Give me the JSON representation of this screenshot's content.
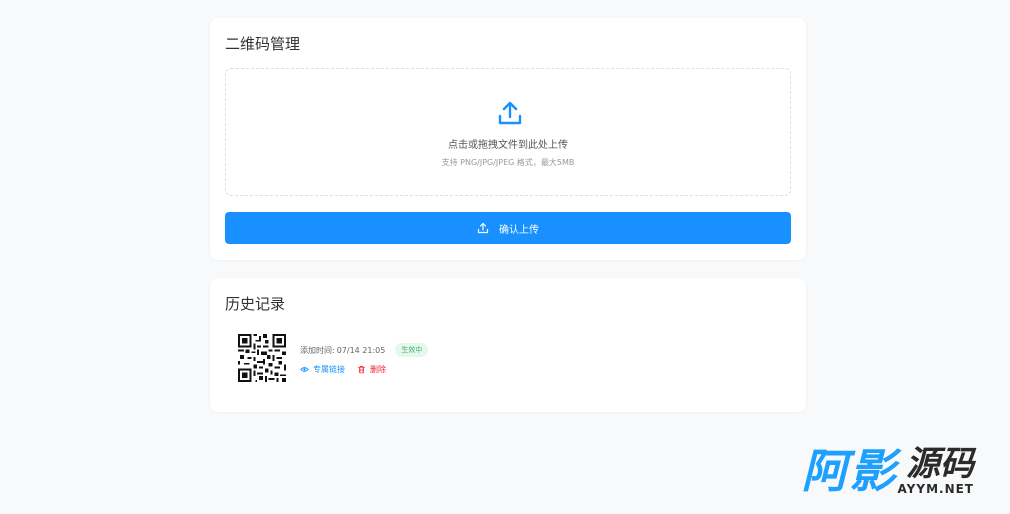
{
  "upload_card": {
    "title": "二维码管理",
    "dropzone": {
      "icon": "upload-icon",
      "main_text": "点击或拖拽文件到此处上传",
      "sub_text": "支持 PNG/JPG/JPEG 格式，最大5MB"
    },
    "confirm_button": {
      "label": "确认上传",
      "icon": "upload-icon"
    }
  },
  "history_card": {
    "title": "历史记录",
    "items": [
      {
        "time_label": "添加时间:",
        "time_value": "07/14 21:05",
        "status": "生效中",
        "actions": [
          {
            "label": "专属链接",
            "icon": "eye-icon"
          },
          {
            "label": "删除",
            "icon": "trash-icon"
          }
        ]
      }
    ]
  },
  "watermark": {
    "logo_text_a": "阿影",
    "logo_text_b": "源码",
    "logo_en": "AYYM.NET"
  },
  "colors": {
    "primary": "#1890ff",
    "danger": "#f5222d",
    "success_text": "#3cb371",
    "success_bg": "#e6f7ec"
  }
}
